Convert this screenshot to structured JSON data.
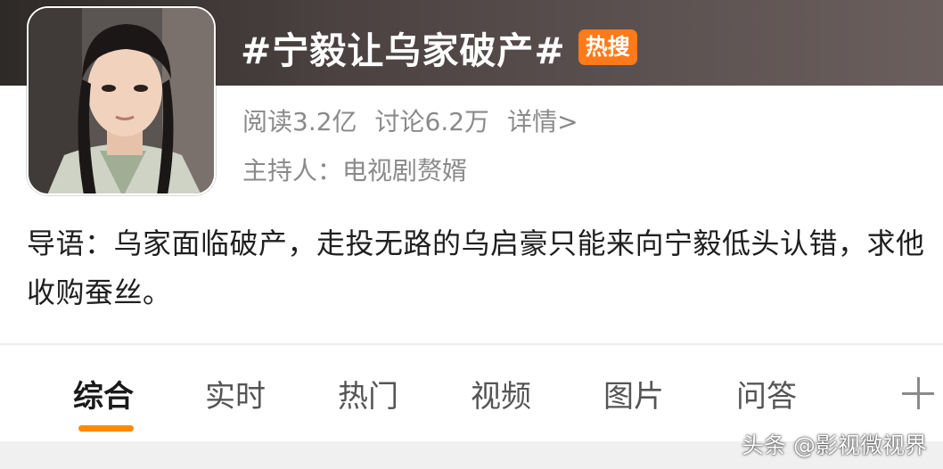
{
  "topic": {
    "title": "#宁毅让乌家破产#",
    "badge": "热搜",
    "reads": "阅读3.2亿",
    "discussions": "讨论6.2万",
    "detail_link": "详情>",
    "host": "主持人：电视剧赘婿",
    "intro": "导语：乌家面临破产，走投无路的乌启豪只能来向宁毅低头认错，求他收购蚕丝。"
  },
  "tabs": [
    {
      "label": "综合"
    },
    {
      "label": "实时"
    },
    {
      "label": "热门"
    },
    {
      "label": "视频"
    },
    {
      "label": "图片"
    },
    {
      "label": "问答"
    }
  ],
  "icons": {
    "add_tab": "plus-icon"
  },
  "colors": {
    "badge": "#ff7a1a",
    "active_underline": "#ff8a00"
  },
  "watermark": "头条 @影视微视界"
}
